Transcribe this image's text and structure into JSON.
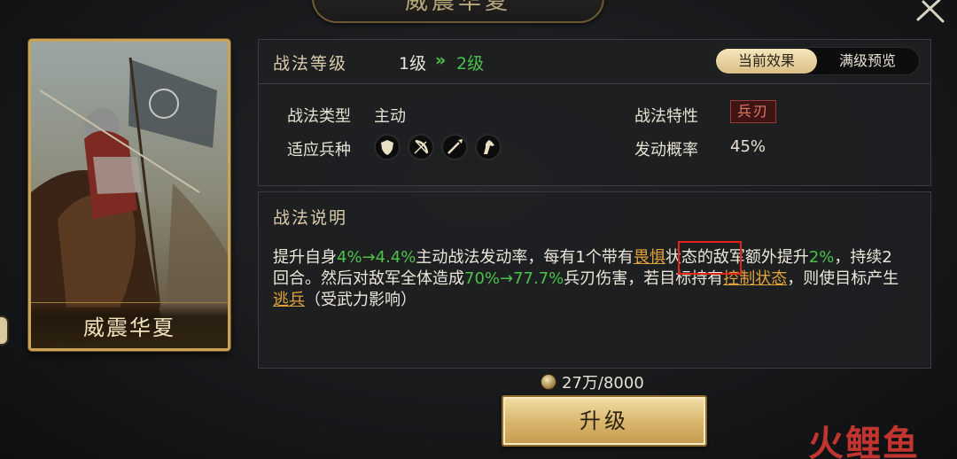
{
  "header": {
    "title": "威震华夏"
  },
  "card": {
    "name": "威震华夏"
  },
  "level": {
    "title": "战法等级",
    "from": "1级",
    "arrow": "»",
    "to": "2级",
    "tabs": {
      "current": "当前效果",
      "preview": "满级预览"
    }
  },
  "info": {
    "type_label": "战法类型",
    "type_value": "主动",
    "trait_label": "战法特性",
    "trait_value": "兵刃",
    "troop_label": "适应兵种",
    "troop_icons": [
      "shield-icon",
      "bow-icon",
      "spear-icon",
      "horse-icon"
    ],
    "rate_label": "发动概率",
    "rate_value": "45%"
  },
  "description": {
    "title": "战法说明",
    "t1": "提升自身",
    "g1": "4%→4.4%",
    "t2": "主动战法发动率，每有1个带有",
    "link1": "畏惧",
    "t3": "状态的敌军额外提升",
    "g2": "2%",
    "t4": "，持续2回合。然后对敌军全体造成",
    "g3": "70%→77.7%",
    "t5": "兵刃伤害，若目标持有",
    "link2": "控制状态",
    "t6": "，则使目标产生",
    "link3": "逃兵",
    "t7": "（受武力影响）"
  },
  "cost": {
    "value": "27万/8000"
  },
  "upgrade": {
    "label": "升级"
  },
  "watermark": "火鲤鱼",
  "colors": {
    "green": "#4cc24a",
    "link": "#e0a23a",
    "gold": "#c9a456",
    "highlight": "#e0241b"
  }
}
